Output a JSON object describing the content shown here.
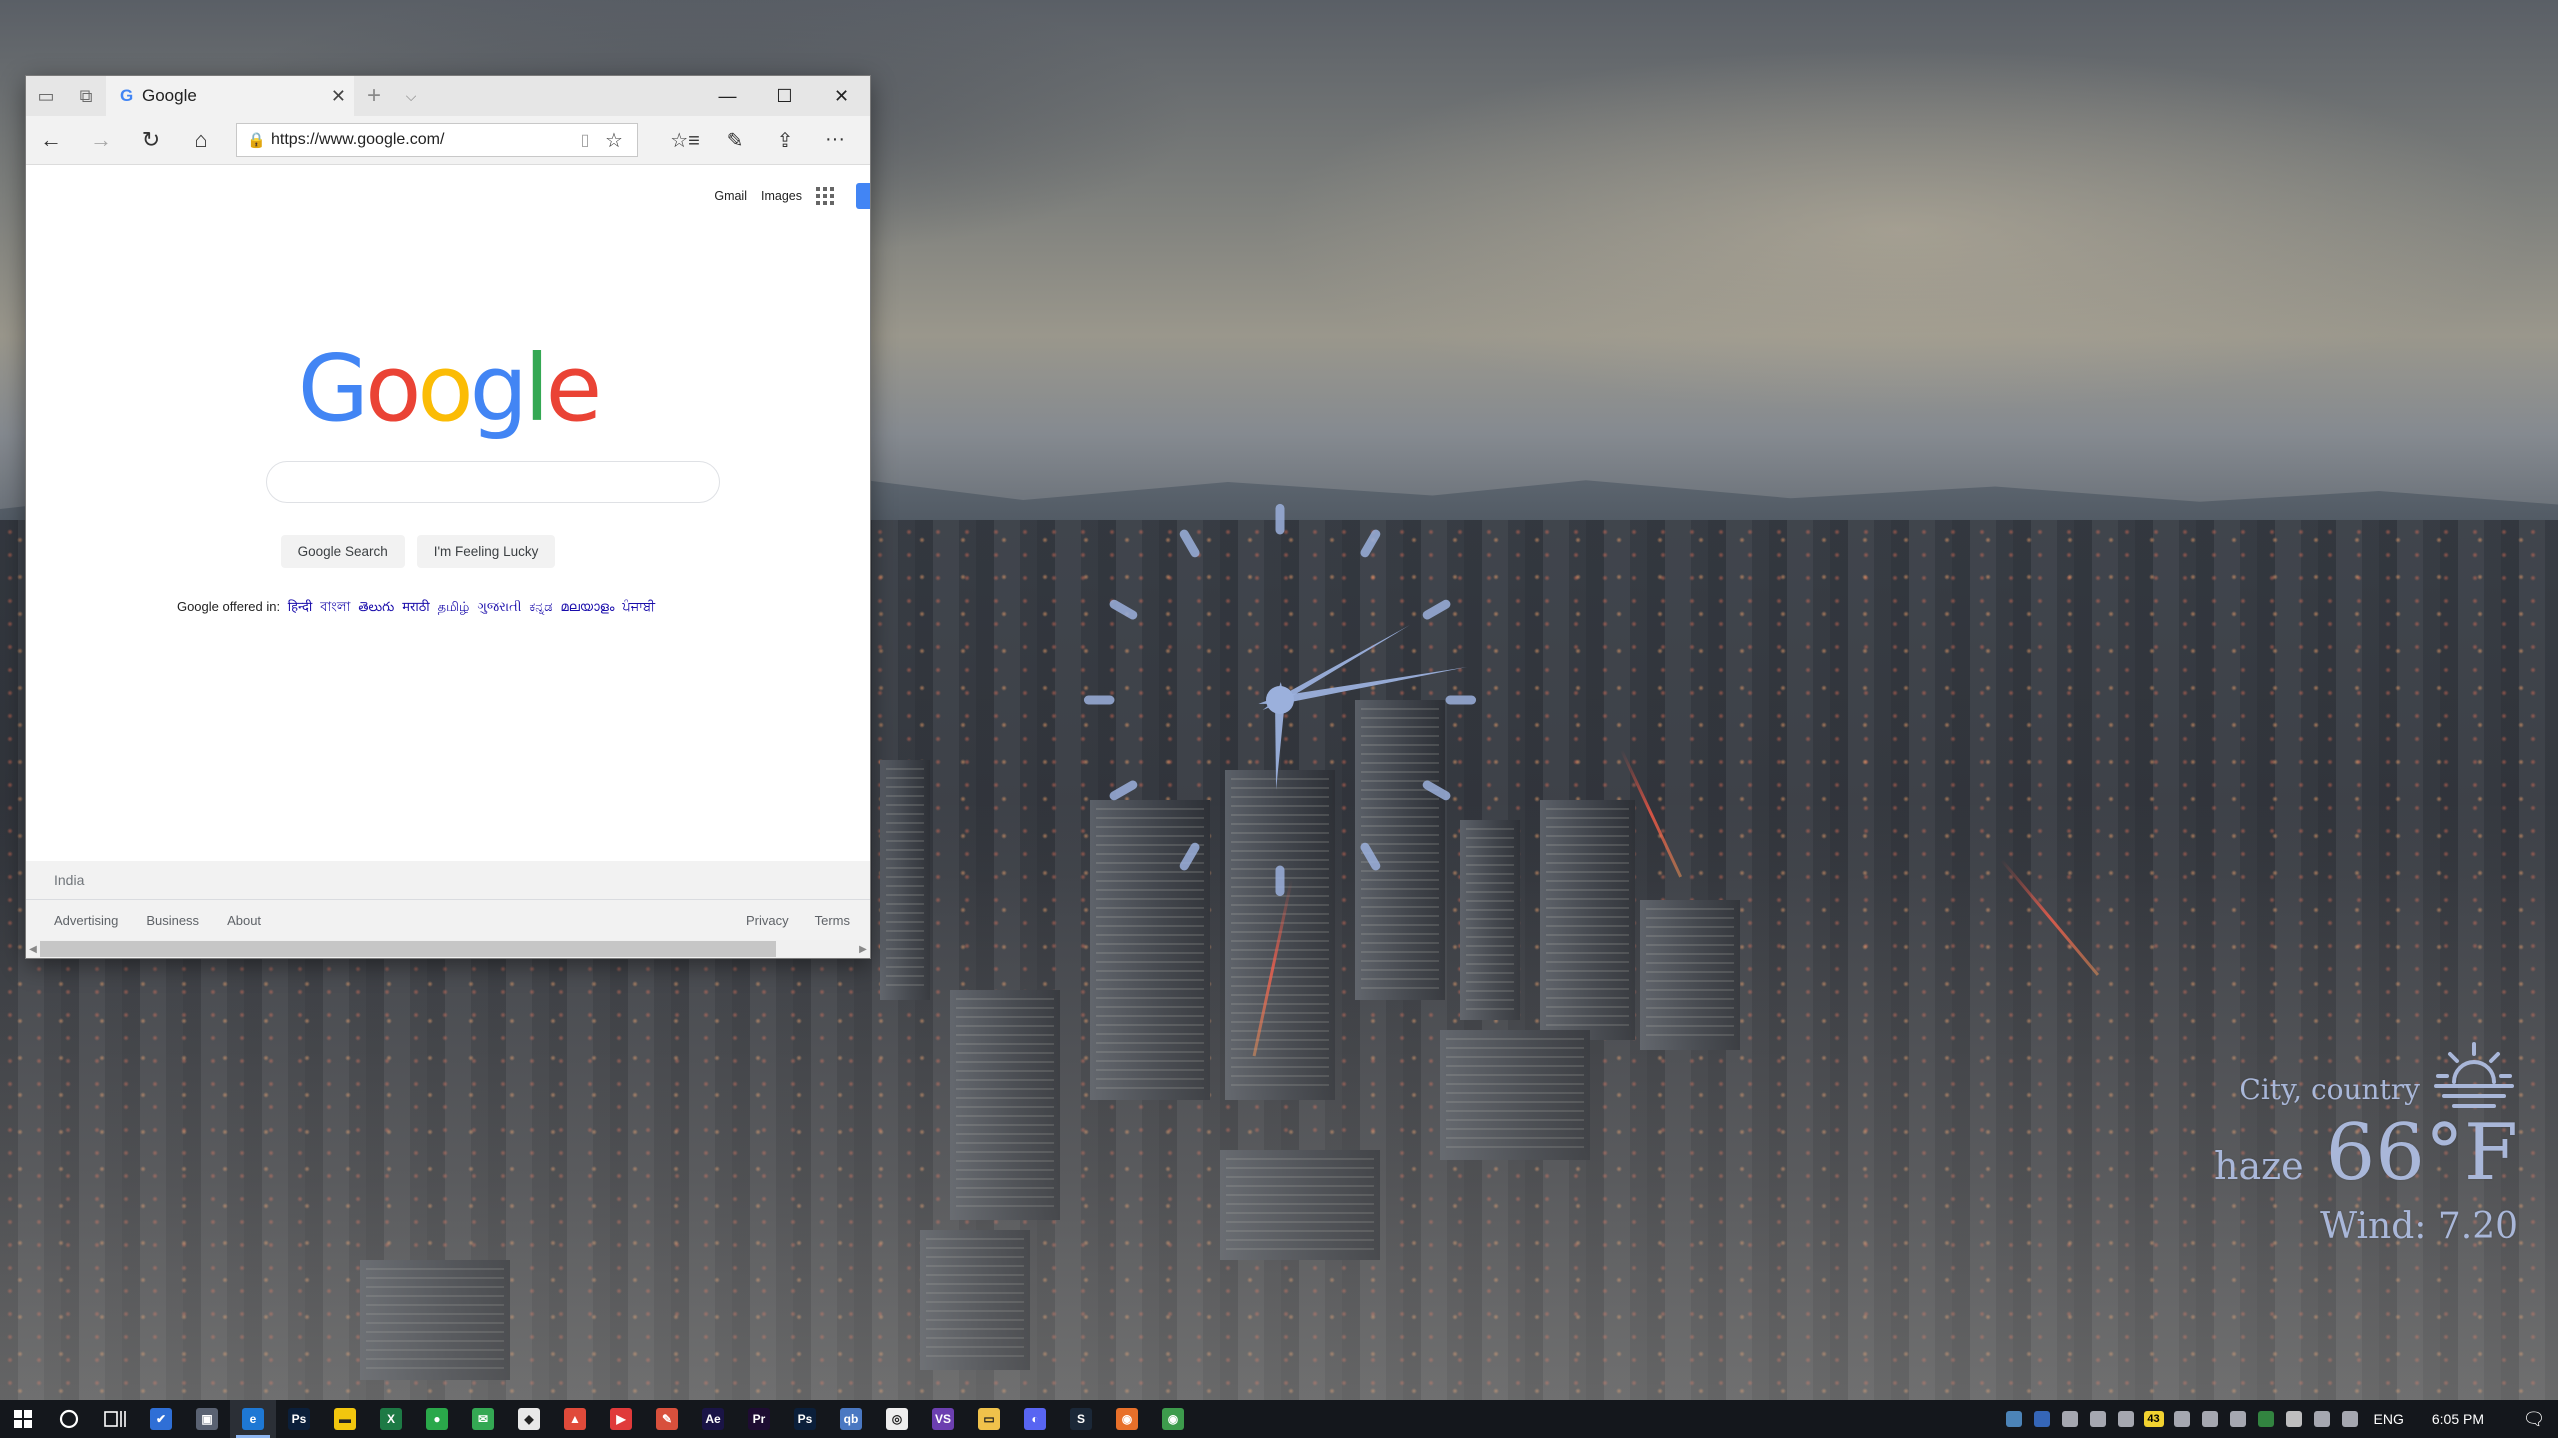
{
  "browser": {
    "tab": {
      "favicon": "G",
      "title": "Google",
      "close": "✕"
    },
    "new_tab": "+",
    "tab_list": "⌵",
    "controls": {
      "minimize": "—",
      "maximize": "☐",
      "close": "✕"
    },
    "nav": {
      "back": "←",
      "forward": "→",
      "refresh": "↻",
      "home": "⌂"
    },
    "address": {
      "lock": "🔒",
      "url": "https://www.google.com/",
      "reading_view": "▯",
      "favorite": "☆"
    },
    "tools": {
      "favorites": "☆≡",
      "notes": "✎",
      "share": "⇪",
      "more": "···"
    }
  },
  "google": {
    "top_links": [
      "Gmail",
      "Images"
    ],
    "logo_letters": [
      {
        "ch": "G",
        "color": "#4285f4"
      },
      {
        "ch": "o",
        "color": "#ea4335"
      },
      {
        "ch": "o",
        "color": "#fbbc05"
      },
      {
        "ch": "g",
        "color": "#4285f4"
      },
      {
        "ch": "l",
        "color": "#34a853"
      },
      {
        "ch": "e",
        "color": "#ea4335"
      }
    ],
    "search_button": "Google Search",
    "lucky_button": "I'm Feeling Lucky",
    "offered_label": "Google offered in:",
    "languages": [
      "हिन्दी",
      "বাংলা",
      "తెలుగు",
      "मराठी",
      "தமிழ்",
      "ગુજરાતી",
      "ಕನ್ನಡ",
      "മലയാളം",
      "ਪੰਜਾਬੀ"
    ],
    "footer": {
      "country": "India",
      "left_links": [
        "Advertising",
        "Business",
        "About"
      ],
      "right_links": [
        "Privacy",
        "Terms"
      ]
    }
  },
  "clock": {
    "color": "#9bb0dc",
    "hour": 6,
    "minute": 5
  },
  "weather": {
    "location": "City, country",
    "condition": "haze",
    "temperature": "66°F",
    "wind": "Wind: 7.20",
    "icon": "sunrise-icon",
    "color": "#a9b7d9"
  },
  "taskbar": {
    "apps": [
      {
        "name": "todo",
        "label": "✔",
        "color": "#2f6fd6"
      },
      {
        "name": "store",
        "label": "▣",
        "color": "#5a6272"
      },
      {
        "name": "edge",
        "label": "e",
        "color": "#1e78d4",
        "active": true
      },
      {
        "name": "photoshop",
        "label": "Ps",
        "color": "#0b1f3a"
      },
      {
        "name": "sticky-notes",
        "label": "▬",
        "color": "#f2c60e"
      },
      {
        "name": "excel",
        "label": "X",
        "color": "#1d7a45"
      },
      {
        "name": "chat",
        "label": "●",
        "color": "#2aa84a"
      },
      {
        "name": "mail",
        "label": "✉",
        "color": "#34a853"
      },
      {
        "name": "android",
        "label": "◆",
        "color": "#e8e8e8"
      },
      {
        "name": "popcorn",
        "label": "▲",
        "color": "#e04a3a"
      },
      {
        "name": "media",
        "label": "▶",
        "color": "#e03a3a"
      },
      {
        "name": "pencil",
        "label": "✎",
        "color": "#d8503c"
      },
      {
        "name": "after-effects",
        "label": "Ae",
        "color": "#1a1446"
      },
      {
        "name": "premiere",
        "label": "Pr",
        "color": "#1e0c32"
      },
      {
        "name": "photoshop-2",
        "label": "Ps",
        "color": "#0b1f3a"
      },
      {
        "name": "qbittorrent",
        "label": "qb",
        "color": "#4a78c2"
      },
      {
        "name": "obs",
        "label": "◎",
        "color": "#eeeeee"
      },
      {
        "name": "visual-studio",
        "label": "VS",
        "color": "#6c3fb0"
      },
      {
        "name": "file-explorer",
        "label": "▭",
        "color": "#f0c24b"
      },
      {
        "name": "discord",
        "label": "◐",
        "color": "#5865f2"
      },
      {
        "name": "steam",
        "label": "S",
        "color": "#1b2838"
      },
      {
        "name": "firefox",
        "label": "◉",
        "color": "#e8702a"
      },
      {
        "name": "chrome",
        "label": "◉",
        "color": "#3d9b4c"
      }
    ],
    "tray_icons": [
      {
        "name": "photos",
        "color": "#5aa0e0"
      },
      {
        "name": "malwarebytes",
        "color": "#3d7be0"
      },
      {
        "name": "discord-tray",
        "color": "#c9ccd6"
      },
      {
        "name": "vs-tray",
        "color": "#c9ccd6"
      },
      {
        "name": "steam-tray",
        "color": "#c9ccd6"
      },
      {
        "name": "counter-43",
        "color": "#f2d230"
      },
      {
        "name": "keyboard",
        "color": "#c9ccd6"
      },
      {
        "name": "network",
        "color": "#c9ccd6"
      },
      {
        "name": "volume",
        "color": "#c9ccd6"
      },
      {
        "name": "flag",
        "color": "#3aa04a"
      },
      {
        "name": "defender",
        "color": "#e8e8e8"
      },
      {
        "name": "battery",
        "color": "#c9ccd6"
      },
      {
        "name": "pen",
        "color": "#c9ccd6"
      }
    ],
    "tray_badge": "43",
    "language": "ENG",
    "time": "6:05 PM"
  }
}
